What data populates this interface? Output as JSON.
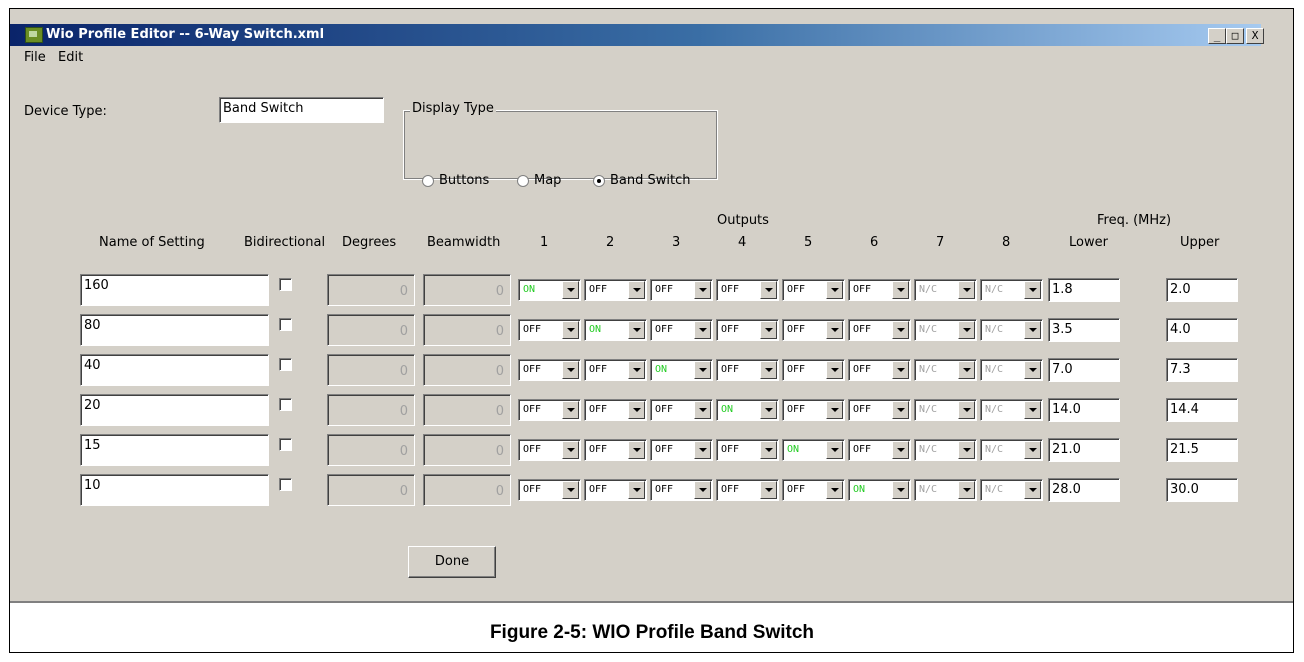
{
  "window": {
    "title": "Wio Profile Editor -- 6-Way Switch.xml",
    "controls": {
      "minimize": "_",
      "maximize": "□",
      "close": "X"
    }
  },
  "menu": {
    "file": "File",
    "edit": "Edit"
  },
  "device_type": {
    "label": "Device Type:",
    "value": "Band Switch"
  },
  "display_type": {
    "title": "Display Type",
    "options": [
      {
        "label": "Buttons",
        "selected": false
      },
      {
        "label": "Map",
        "selected": false
      },
      {
        "label": "Band Switch",
        "selected": true
      }
    ]
  },
  "headers": {
    "outputs_group": "Outputs",
    "freq_group": "Freq. (MHz)",
    "name": "Name of Setting",
    "bidirectional": "Bidirectional",
    "degrees": "Degrees",
    "beamwidth": "Beamwidth",
    "outputs": [
      "1",
      "2",
      "3",
      "4",
      "5",
      "6",
      "7",
      "8"
    ],
    "lower": "Lower",
    "upper": "Upper"
  },
  "rows": [
    {
      "name": "160",
      "bidirectional": false,
      "degrees": "0",
      "beamwidth": "0",
      "outputs": [
        "ON",
        "OFF",
        "OFF",
        "OFF",
        "OFF",
        "OFF",
        "N/C",
        "N/C"
      ],
      "lower": "1.8",
      "upper": "2.0"
    },
    {
      "name": "80",
      "bidirectional": false,
      "degrees": "0",
      "beamwidth": "0",
      "outputs": [
        "OFF",
        "ON",
        "OFF",
        "OFF",
        "OFF",
        "OFF",
        "N/C",
        "N/C"
      ],
      "lower": "3.5",
      "upper": "4.0"
    },
    {
      "name": "40",
      "bidirectional": false,
      "degrees": "0",
      "beamwidth": "0",
      "outputs": [
        "OFF",
        "OFF",
        "ON",
        "OFF",
        "OFF",
        "OFF",
        "N/C",
        "N/C"
      ],
      "lower": "7.0",
      "upper": "7.3"
    },
    {
      "name": "20",
      "bidirectional": false,
      "degrees": "0",
      "beamwidth": "0",
      "outputs": [
        "OFF",
        "OFF",
        "OFF",
        "ON",
        "OFF",
        "OFF",
        "N/C",
        "N/C"
      ],
      "lower": "14.0",
      "upper": "14.4"
    },
    {
      "name": "15",
      "bidirectional": false,
      "degrees": "0",
      "beamwidth": "0",
      "outputs": [
        "OFF",
        "OFF",
        "OFF",
        "OFF",
        "ON",
        "OFF",
        "N/C",
        "N/C"
      ],
      "lower": "21.0",
      "upper": "21.5"
    },
    {
      "name": "10",
      "bidirectional": false,
      "degrees": "0",
      "beamwidth": "0",
      "outputs": [
        "OFF",
        "OFF",
        "OFF",
        "OFF",
        "OFF",
        "ON",
        "N/C",
        "N/C"
      ],
      "lower": "28.0",
      "upper": "30.0"
    }
  ],
  "done_label": "Done",
  "caption": "Figure 2-5: WIO Profile Band Switch"
}
